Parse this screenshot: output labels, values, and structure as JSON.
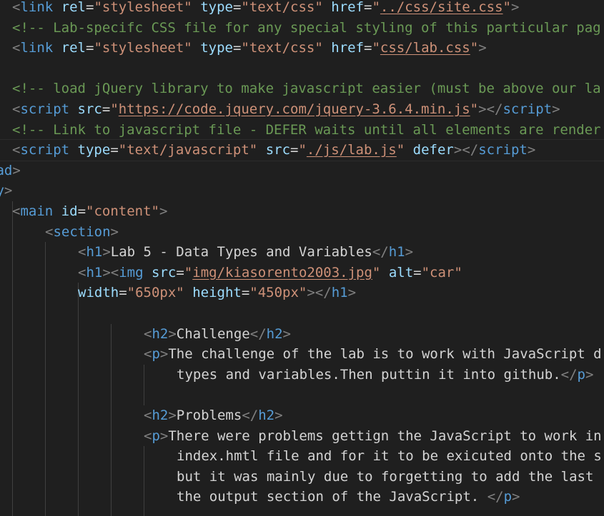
{
  "editor": {
    "lines": [
      {
        "indent": "sp1",
        "tokens": [
          {
            "t": "tag",
            "v": "<"
          },
          {
            "t": "tname",
            "v": "link"
          },
          {
            "t": "text",
            "v": " "
          },
          {
            "t": "attr",
            "v": "rel"
          },
          {
            "t": "eq",
            "v": "="
          },
          {
            "t": "str",
            "v": "\"stylesheet\""
          },
          {
            "t": "text",
            "v": " "
          },
          {
            "t": "attr",
            "v": "type"
          },
          {
            "t": "eq",
            "v": "="
          },
          {
            "t": "str",
            "v": "\"text/css\""
          },
          {
            "t": "text",
            "v": " "
          },
          {
            "t": "attr",
            "v": "href"
          },
          {
            "t": "eq",
            "v": "="
          },
          {
            "t": "str",
            "v": "\""
          },
          {
            "t": "link",
            "v": "../css/site.css"
          },
          {
            "t": "str",
            "v": "\""
          },
          {
            "t": "tag",
            "v": ">"
          }
        ]
      },
      {
        "indent": "sp1",
        "tokens": [
          {
            "t": "comment",
            "v": "<!-- Lab-specifc CSS file for any special styling of this particular pag"
          }
        ]
      },
      {
        "indent": "sp1",
        "tokens": [
          {
            "t": "tag",
            "v": "<"
          },
          {
            "t": "tname",
            "v": "link"
          },
          {
            "t": "text",
            "v": " "
          },
          {
            "t": "attr",
            "v": "rel"
          },
          {
            "t": "eq",
            "v": "="
          },
          {
            "t": "str",
            "v": "\"stylesheet\""
          },
          {
            "t": "text",
            "v": " "
          },
          {
            "t": "attr",
            "v": "type"
          },
          {
            "t": "eq",
            "v": "="
          },
          {
            "t": "str",
            "v": "\"text/css\""
          },
          {
            "t": "text",
            "v": " "
          },
          {
            "t": "attr",
            "v": "href"
          },
          {
            "t": "eq",
            "v": "="
          },
          {
            "t": "str",
            "v": "\""
          },
          {
            "t": "link",
            "v": "css/lab.css"
          },
          {
            "t": "str",
            "v": "\""
          },
          {
            "t": "tag",
            "v": ">"
          }
        ]
      },
      {
        "indent": "sp1",
        "tokens": []
      },
      {
        "indent": "sp1",
        "tokens": [
          {
            "t": "comment",
            "v": "<!-- load jQuery library to make javascript easier (must be above our la"
          }
        ]
      },
      {
        "indent": "sp1",
        "tokens": [
          {
            "t": "tag",
            "v": "<"
          },
          {
            "t": "tname",
            "v": "script"
          },
          {
            "t": "text",
            "v": " "
          },
          {
            "t": "attr",
            "v": "src"
          },
          {
            "t": "eq",
            "v": "="
          },
          {
            "t": "str",
            "v": "\""
          },
          {
            "t": "link",
            "v": "https://code.jquery.com/jquery-3.6.4.min.js"
          },
          {
            "t": "str",
            "v": "\""
          },
          {
            "t": "tag",
            "v": "></"
          },
          {
            "t": "tname",
            "v": "script"
          },
          {
            "t": "tag",
            "v": ">"
          }
        ]
      },
      {
        "indent": "sp1",
        "tokens": [
          {
            "t": "comment",
            "v": "<!-- Link to javascript file - DEFER waits until all elements are render"
          }
        ]
      },
      {
        "indent": "sp1",
        "current": true,
        "tokens": [
          {
            "t": "tag",
            "v": "<"
          },
          {
            "t": "tname",
            "v": "script"
          },
          {
            "t": "text",
            "v": " "
          },
          {
            "t": "attr",
            "v": "type"
          },
          {
            "t": "eq",
            "v": "="
          },
          {
            "t": "str",
            "v": "\"text/javascript\""
          },
          {
            "t": "text",
            "v": " "
          },
          {
            "t": "attr",
            "v": "src"
          },
          {
            "t": "eq",
            "v": "="
          },
          {
            "t": "str",
            "v": "\""
          },
          {
            "t": "link",
            "v": "./js/lab.js"
          },
          {
            "t": "str",
            "v": "\""
          },
          {
            "t": "text",
            "v": " "
          },
          {
            "t": "attr",
            "v": "defer"
          },
          {
            "t": "tag",
            "v": "></"
          },
          {
            "t": "tname",
            "v": "script"
          },
          {
            "t": "tag",
            "v": ">"
          }
        ]
      },
      {
        "indent": "neg",
        "tokens": [
          {
            "t": "tname",
            "v": "ead"
          },
          {
            "t": "tag",
            "v": ">"
          }
        ]
      },
      {
        "indent": "neg",
        "tokens": [
          {
            "t": "tname",
            "v": "dy"
          },
          {
            "t": "tag",
            "v": ">"
          }
        ]
      },
      {
        "indent": "sp1",
        "tokens": [
          {
            "t": "tag",
            "v": "<"
          },
          {
            "t": "tname",
            "v": "main"
          },
          {
            "t": "text",
            "v": " "
          },
          {
            "t": "attr",
            "v": "id"
          },
          {
            "t": "eq",
            "v": "="
          },
          {
            "t": "str",
            "v": "\"content\""
          },
          {
            "t": "tag",
            "v": ">"
          }
        ]
      },
      {
        "indent": "sp2",
        "tokens": [
          {
            "t": "tag",
            "v": "<"
          },
          {
            "t": "tname",
            "v": "section"
          },
          {
            "t": "tag",
            "v": ">"
          }
        ]
      },
      {
        "indent": "sp3",
        "tokens": [
          {
            "t": "tag",
            "v": "<"
          },
          {
            "t": "tname",
            "v": "h1"
          },
          {
            "t": "tag",
            "v": ">"
          },
          {
            "t": "text",
            "v": "Lab 5 - Data Types and Variables"
          },
          {
            "t": "tag",
            "v": "</"
          },
          {
            "t": "tname",
            "v": "h1"
          },
          {
            "t": "tag",
            "v": ">"
          }
        ]
      },
      {
        "indent": "sp3",
        "tokens": [
          {
            "t": "tag",
            "v": "<"
          },
          {
            "t": "tname",
            "v": "h1"
          },
          {
            "t": "tag",
            "v": "><"
          },
          {
            "t": "tname",
            "v": "img"
          },
          {
            "t": "text",
            "v": " "
          },
          {
            "t": "attr",
            "v": "src"
          },
          {
            "t": "eq",
            "v": "="
          },
          {
            "t": "str",
            "v": "\""
          },
          {
            "t": "link",
            "v": "img/kiasorento2003.jpg"
          },
          {
            "t": "str",
            "v": "\""
          },
          {
            "t": "text",
            "v": " "
          },
          {
            "t": "attr",
            "v": "alt"
          },
          {
            "t": "eq",
            "v": "="
          },
          {
            "t": "str",
            "v": "\"car\""
          }
        ]
      },
      {
        "indent": "sp3",
        "tokens": [
          {
            "t": "attr",
            "v": "width"
          },
          {
            "t": "eq",
            "v": "="
          },
          {
            "t": "str",
            "v": "\"650px\""
          },
          {
            "t": "text",
            "v": " "
          },
          {
            "t": "attr",
            "v": "height"
          },
          {
            "t": "eq",
            "v": "="
          },
          {
            "t": "str",
            "v": "\"450px\""
          },
          {
            "t": "tag",
            "v": "></"
          },
          {
            "t": "tname",
            "v": "h1"
          },
          {
            "t": "tag",
            "v": ">"
          }
        ]
      },
      {
        "indent": "sp3",
        "tokens": []
      },
      {
        "indent": "sp4",
        "tokens": [
          {
            "t": "tag",
            "v": "<"
          },
          {
            "t": "tname",
            "v": "h2"
          },
          {
            "t": "tag",
            "v": ">"
          },
          {
            "t": "text",
            "v": "Challenge"
          },
          {
            "t": "tag",
            "v": "</"
          },
          {
            "t": "tname",
            "v": "h2"
          },
          {
            "t": "tag",
            "v": ">"
          }
        ]
      },
      {
        "indent": "sp4",
        "tokens": [
          {
            "t": "tag",
            "v": "<"
          },
          {
            "t": "tname",
            "v": "p"
          },
          {
            "t": "tag",
            "v": ">"
          },
          {
            "t": "text",
            "v": "The challenge of the lab is to work with JavaScript d"
          }
        ]
      },
      {
        "indent": "sp5",
        "tokens": [
          {
            "t": "text",
            "v": "types and variables.Then puttin it into github."
          },
          {
            "t": "tag",
            "v": "</"
          },
          {
            "t": "tname",
            "v": "p"
          },
          {
            "t": "tag",
            "v": ">"
          }
        ]
      },
      {
        "indent": "sp4",
        "tokens": []
      },
      {
        "indent": "sp4",
        "tokens": [
          {
            "t": "tag",
            "v": "<"
          },
          {
            "t": "tname",
            "v": "h2"
          },
          {
            "t": "tag",
            "v": ">"
          },
          {
            "t": "text",
            "v": "Problems"
          },
          {
            "t": "tag",
            "v": "</"
          },
          {
            "t": "tname",
            "v": "h2"
          },
          {
            "t": "tag",
            "v": ">"
          }
        ]
      },
      {
        "indent": "sp4",
        "tokens": [
          {
            "t": "tag",
            "v": "<"
          },
          {
            "t": "tname",
            "v": "p"
          },
          {
            "t": "tag",
            "v": ">"
          },
          {
            "t": "text",
            "v": "There were problems gettign the JavaScript to work in"
          }
        ]
      },
      {
        "indent": "sp5",
        "tokens": [
          {
            "t": "text",
            "v": "index.hmtl file and for it to be exicuted onto the s"
          }
        ]
      },
      {
        "indent": "sp5",
        "tokens": [
          {
            "t": "text",
            "v": "but it was mainly due to forgetting to add the last"
          }
        ]
      },
      {
        "indent": "sp5",
        "tokens": [
          {
            "t": "text",
            "v": "the output section of the JavaScript. "
          },
          {
            "t": "tag",
            "v": "</"
          },
          {
            "t": "tname",
            "v": "p"
          },
          {
            "t": "tag",
            "v": ">"
          }
        ]
      },
      {
        "indent": "sp5",
        "tokens": []
      }
    ]
  }
}
